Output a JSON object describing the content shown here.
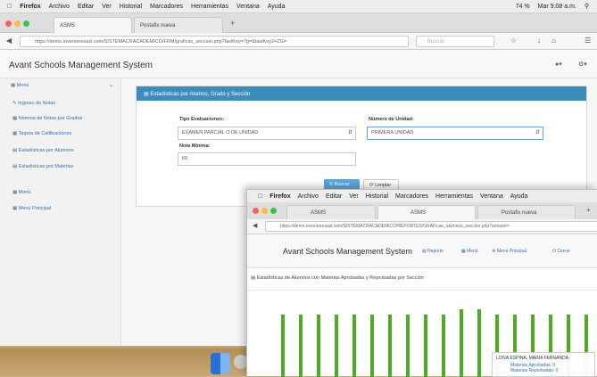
{
  "os_menubar": {
    "app": "Firefox",
    "items": [
      "Archivo",
      "Editar",
      "Ver",
      "Historial",
      "Marcadores",
      "Herramientas",
      "Ventana",
      "Ayuda"
    ],
    "status": "74 %",
    "clock": "Mar 9:08 a.m."
  },
  "browser": {
    "tabs": [
      {
        "label": "ASMS"
      },
      {
        "label": "Postafix nueva"
      }
    ],
    "url": "https://demo.inversoresasl.com/SISTEMACRACADEMICO/FRM/graficas_seccion.php?lastKey=?g=&lastKey2=ZG=",
    "search_placeholder": "Buscar"
  },
  "app": {
    "title": "Avant Schools Management System"
  },
  "sidebar": {
    "menu_label": "Menú",
    "items": [
      {
        "label": "Ingreso de Notas"
      },
      {
        "label": "Nómina de Notas por Grados"
      },
      {
        "label": "Tarjeta de Calificaciones"
      },
      {
        "label": "Estadísticas por Alumnos"
      },
      {
        "label": "Estadísticas por Materias"
      }
    ],
    "section2": "Menú",
    "principal": "Menú Principal"
  },
  "panel": {
    "title": "Estadísticas por Alumno, Grado y Sección",
    "tipo_label": "Tipo Evaluaciones:",
    "tipo_value": "EXAMEN PARCIAL O DE UNIDAD",
    "unidad_label": "Número de Unidad:",
    "unidad_value": "PRIMERA UNIDAD",
    "nota_label": "Nota Mínima:",
    "nota_value": "60",
    "buscar": "Buscar",
    "limpiar": "Limpiar"
  },
  "window2": {
    "menubar_items": [
      "Firefox",
      "Archivo",
      "Editar",
      "Ver",
      "Historial",
      "Marcadores",
      "Herramientas",
      "Ventana",
      "Ayuda"
    ],
    "tabs": [
      {
        "label": "ASMS"
      },
      {
        "label": "ASMS"
      },
      {
        "label": "Postafix nueva"
      }
    ],
    "url": "https://demo.inversoresasl.com/SISTEMACRACADEMICO/REPORTES/GRAFicas_alumnos_seccion.php?amount=",
    "title": "Avant Schools Management System",
    "nav": [
      "Reporte",
      "Menú",
      "Menú Principal",
      "Cerrar"
    ],
    "chart_title": "Estadísticas de Alumnos con Materias Aprobadas y Reprobadas por Sección",
    "tooltip_name": "LOIVA ESPINA, MARIA FERNANDA",
    "tooltip_line1": "Materias Aprobadas: 9",
    "tooltip_line2": "Materias Reprobadas: 0"
  },
  "colors": {
    "primary": "#3c8dbc",
    "bar": "#4cae1f"
  }
}
